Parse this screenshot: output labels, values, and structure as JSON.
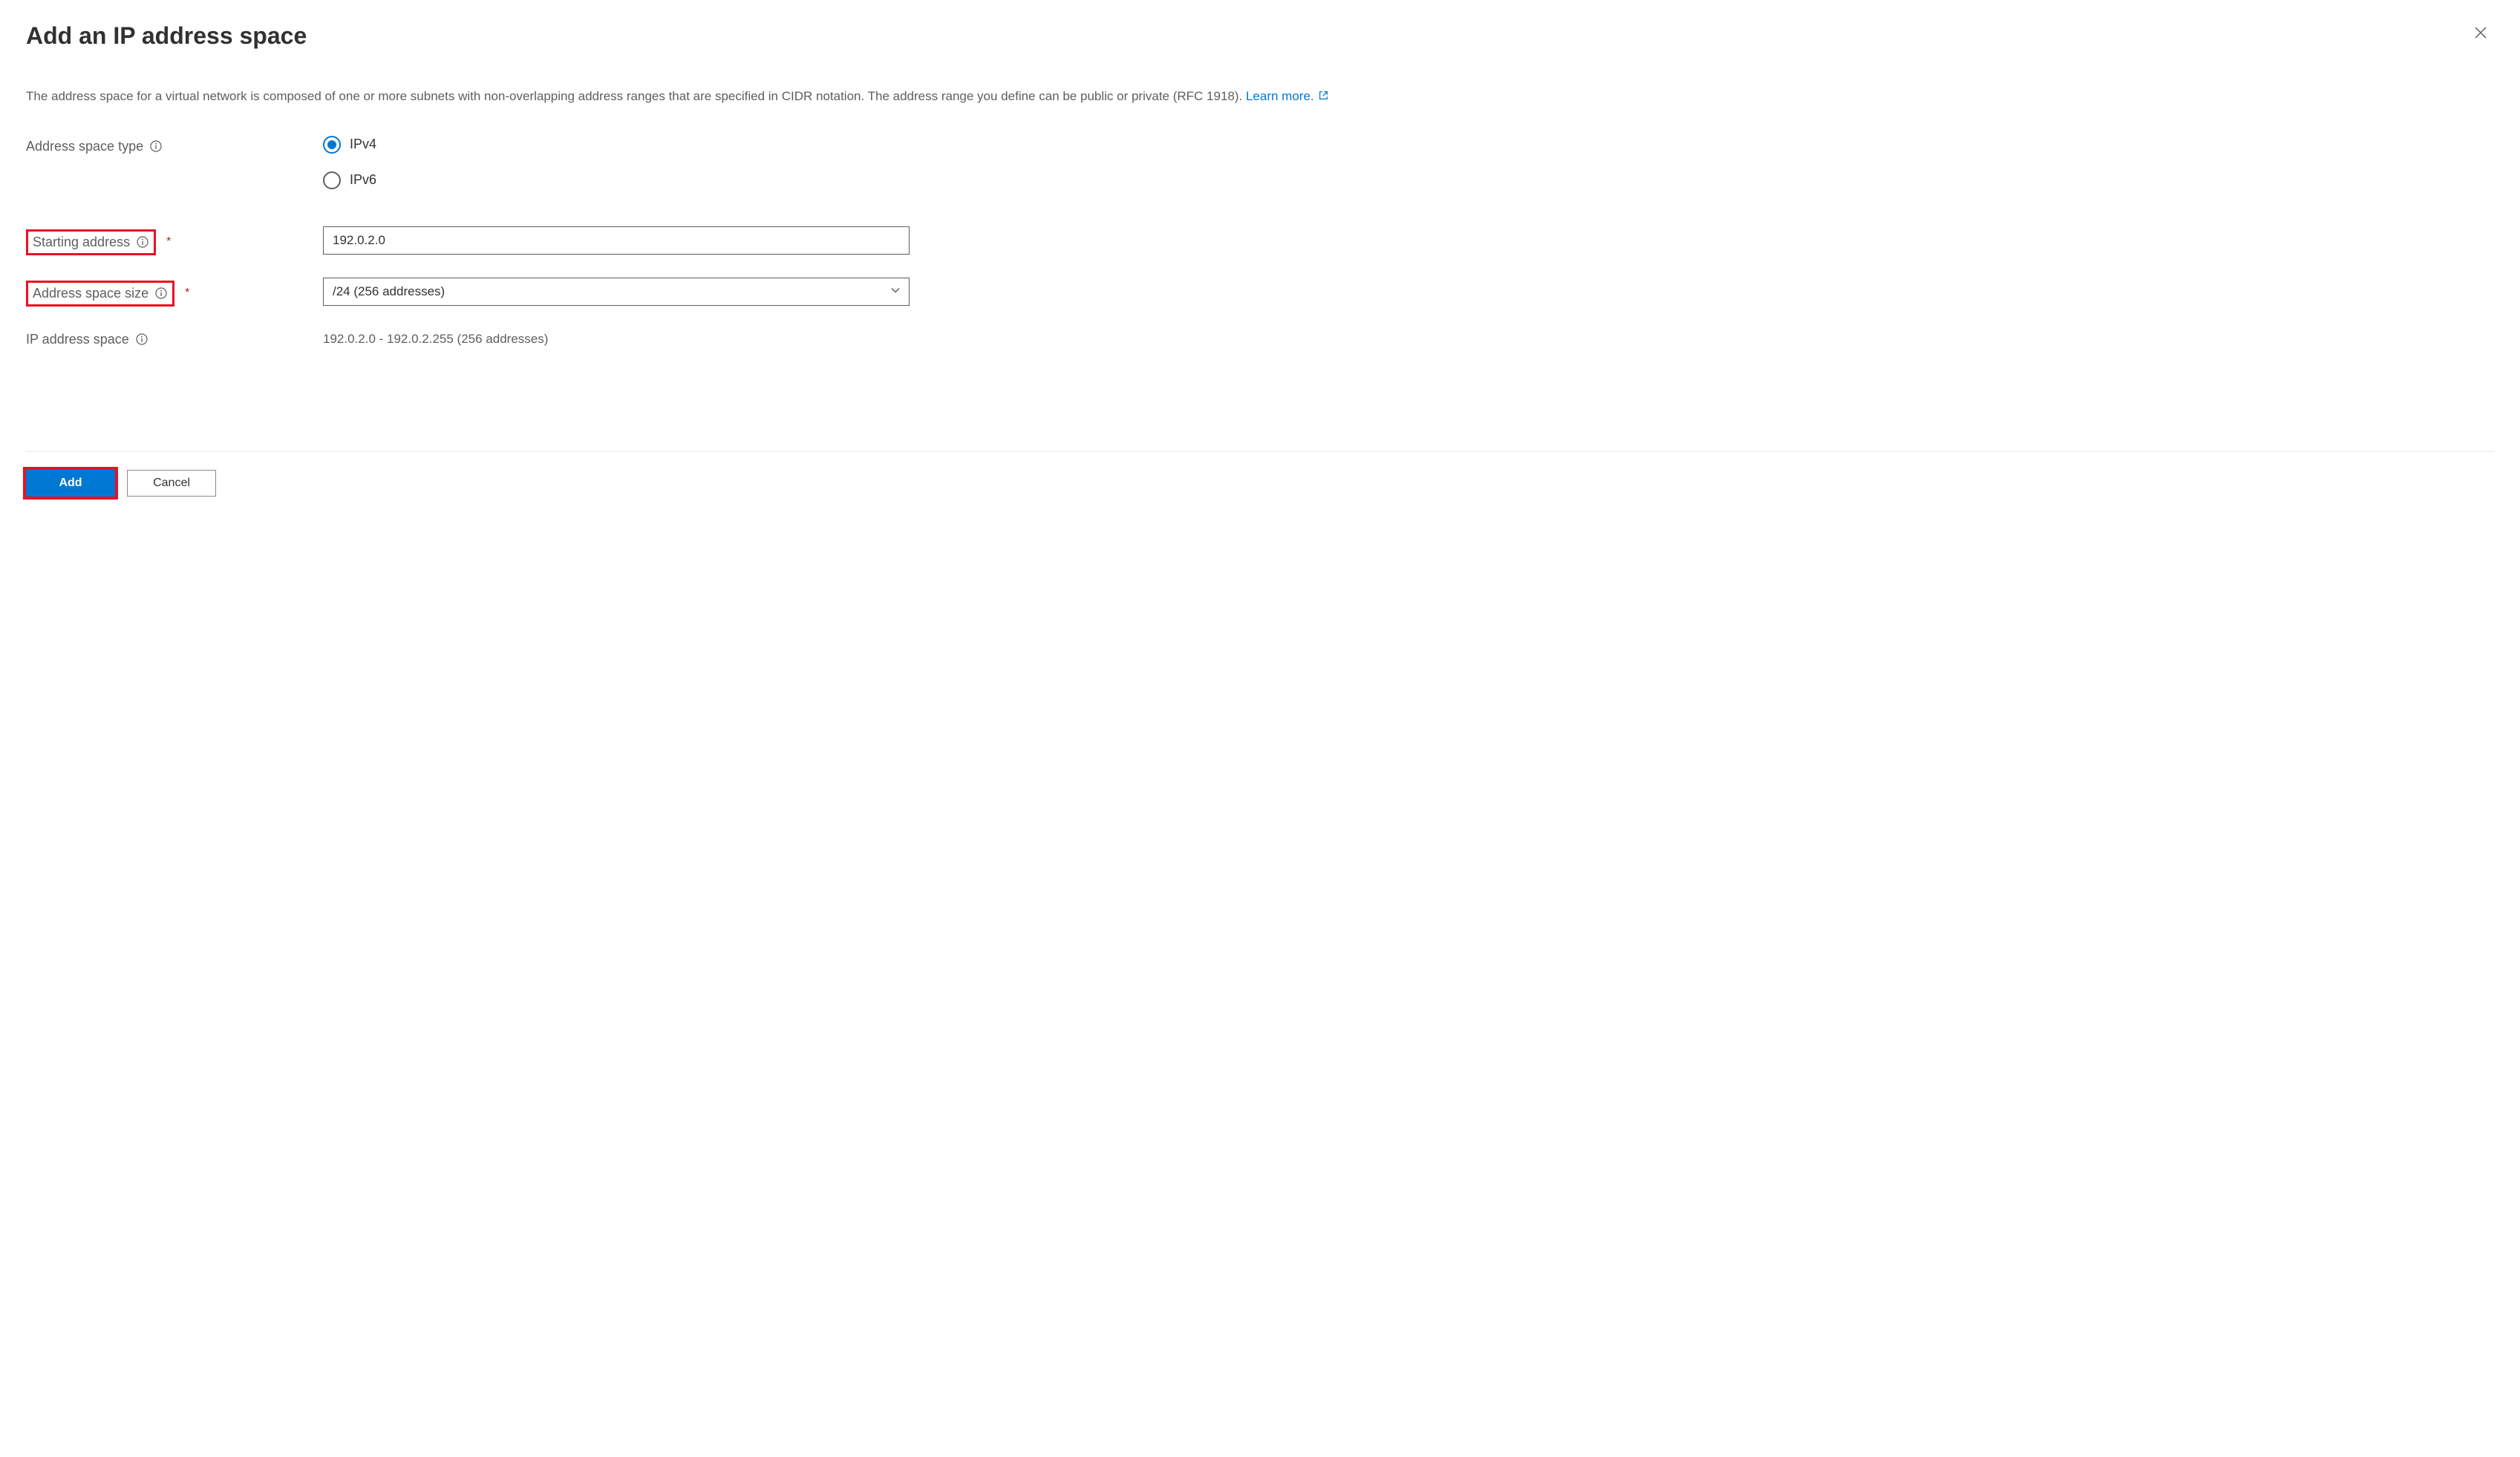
{
  "header": {
    "title": "Add an IP address space"
  },
  "description": {
    "text_before_link": "The address space for a virtual network is composed of one or more subnets with non-overlapping address ranges that are specified in CIDR notation. The address range you define can be public or private (RFC 1918). ",
    "link_text": "Learn more."
  },
  "form": {
    "address_space_type": {
      "label": "Address space type",
      "options": {
        "ipv4": "IPv4",
        "ipv6": "IPv6"
      },
      "selected": "ipv4"
    },
    "starting_address": {
      "label": "Starting address",
      "value": "192.0.2.0"
    },
    "address_space_size": {
      "label": "Address space size",
      "value": "/24 (256 addresses)"
    },
    "ip_address_space": {
      "label": "IP address space",
      "value": "192.0.2.0 - 192.0.2.255 (256 addresses)"
    }
  },
  "footer": {
    "add_label": "Add",
    "cancel_label": "Cancel"
  }
}
